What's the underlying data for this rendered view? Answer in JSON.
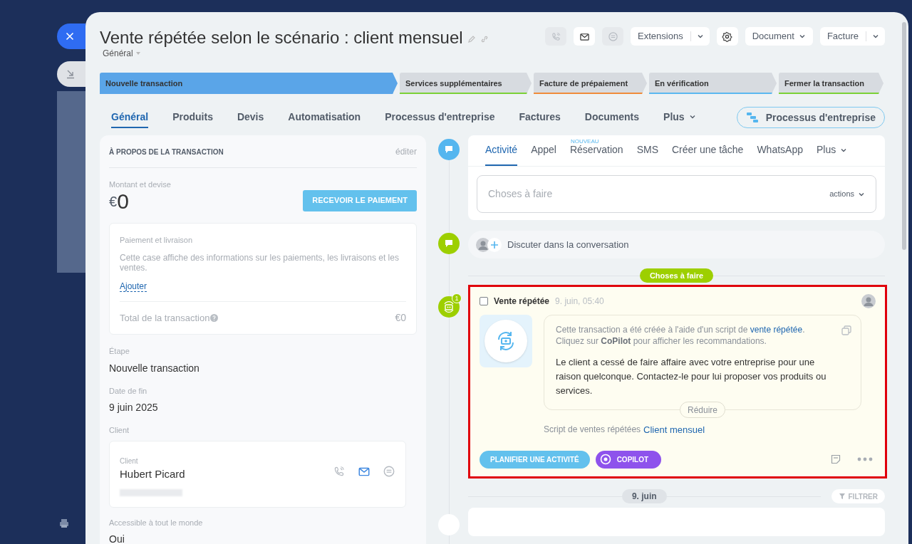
{
  "header": {
    "title": "Vente répétée selon le scénario : client mensuel",
    "category": "Général",
    "toolbar": [
      {
        "kind": "phone",
        "disabled": true
      },
      {
        "kind": "mail",
        "disabled": false
      },
      {
        "kind": "chat",
        "disabled": true
      },
      {
        "kind": "split",
        "label": "Extensions"
      },
      {
        "kind": "gear",
        "disabled": false
      },
      {
        "kind": "dropdown",
        "label": "Document"
      },
      {
        "kind": "split",
        "label": "Facture"
      }
    ]
  },
  "stages": [
    {
      "label": "Nouvelle transaction",
      "selected": true,
      "color": "#5aa5e8"
    },
    {
      "label": "Services supplémentaires",
      "selected": false,
      "color": "#7bd136"
    },
    {
      "label": "Facture de prépaiement",
      "selected": false,
      "color": "#f08b3a"
    },
    {
      "label": "En vérification",
      "selected": false,
      "color": "#5bb8f0"
    },
    {
      "label": "Fermer la transaction",
      "selected": false,
      "color": "#7bd136"
    }
  ],
  "tabs": [
    {
      "label": "Général",
      "selected": true,
      "menu": false
    },
    {
      "label": "Produits",
      "selected": false,
      "menu": false
    },
    {
      "label": "Devis",
      "selected": false,
      "menu": false
    },
    {
      "label": "Automatisation",
      "selected": false,
      "menu": false
    },
    {
      "label": "Processus d'entreprise",
      "selected": false,
      "menu": false
    },
    {
      "label": "Factures",
      "selected": false,
      "menu": false
    },
    {
      "label": "Documents",
      "selected": false,
      "menu": false
    },
    {
      "label": "Plus",
      "selected": false,
      "menu": true
    }
  ],
  "process_button": "Processus d'entreprise",
  "deal": {
    "heading": "À PROPOS DE LA TRANSACTION",
    "edit": "éditer",
    "amount_label": "Montant et devise",
    "currency": "€",
    "amount": "0",
    "pay_button": "RECEVOIR LE PAIEMENT",
    "payment_box": {
      "title": "Paiement et livraison",
      "text": "Cette case affiche des informations sur les paiements, les livraisons et les ventes.",
      "add_link": "Ajouter",
      "total_label": "Total de la transaction",
      "total": "€0"
    },
    "fields": [
      {
        "kind": "text",
        "label": "Étape",
        "value": "Nouvelle transaction"
      },
      {
        "kind": "text",
        "label": "Date de fin",
        "value": "9 juin 2025"
      },
      {
        "kind": "client",
        "label": "Client",
        "client_label": "Client",
        "name": "Hubert Picard"
      },
      {
        "kind": "text",
        "label": "Accessible à tout le monde",
        "value": "Oui"
      }
    ]
  },
  "editor": {
    "tabs": [
      {
        "label": "Activité",
        "selected": true,
        "menu": false
      },
      {
        "label": "Appel",
        "selected": false,
        "menu": false
      },
      {
        "label": "Réservation",
        "selected": false,
        "menu": false,
        "badge": "NOUVEAU"
      },
      {
        "label": "SMS",
        "selected": false,
        "menu": false
      },
      {
        "label": "Créer une tâche",
        "selected": false,
        "menu": false
      },
      {
        "label": "WhatsApp",
        "selected": false,
        "menu": false
      },
      {
        "label": "Plus",
        "selected": false,
        "menu": true
      }
    ],
    "placeholder": "Choses à faire",
    "actions": "actions"
  },
  "chat_row": "Discuter dans la conversation",
  "section_pill": "Choses à faire",
  "task": {
    "checked": false,
    "title": "Vente répétée",
    "time": "9. juin, 05:40",
    "badge": "1",
    "intro_before": "Cette transaction a été créée à l'aide d'un script de ",
    "intro_link": "vente répétée",
    "intro_after": ".",
    "hint": "Cliquez sur **CoPilot** pour afficher les recommandations.",
    "message": "Le client a cessé de faire affaire avec votre entreprise pour une raison quelconque. Contactez-le pour lui proposer vos produits ou services.",
    "collapse": "Réduire",
    "script_label": "Script de ventes répétées",
    "script_link": "Client mensuel",
    "plan_button": "PLANIFIER UNE ACTIVITÉ",
    "copilot_button": "COPILOT"
  },
  "date_pill": "9. juin",
  "filter_button": "FILTRER"
}
